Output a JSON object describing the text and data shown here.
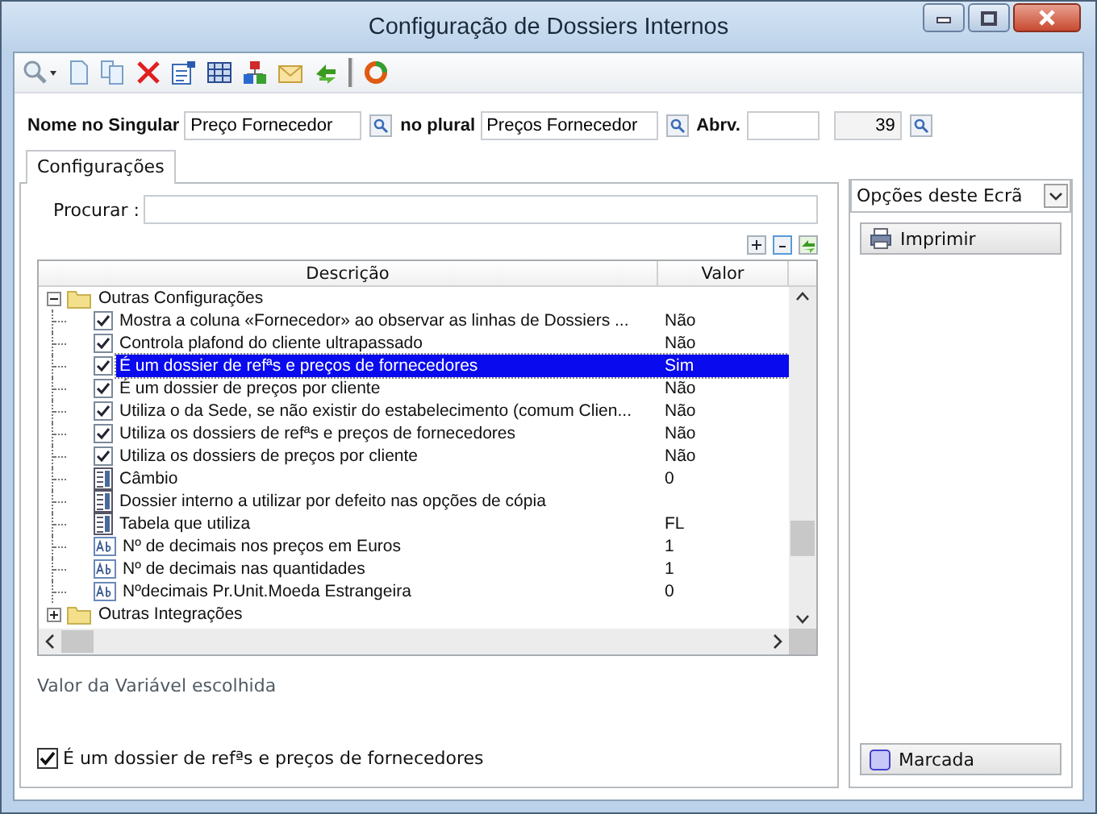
{
  "window": {
    "title": "Configuração de Dossiers Internos"
  },
  "form": {
    "singular_label": "Nome no Singular",
    "singular_value": "Preço Fornecedor",
    "plural_label": "no plural",
    "plural_value": "Preços Fornecedor",
    "abbr_label": "Abrv.",
    "number": "39"
  },
  "tabs": [
    {
      "label": "Configurações",
      "selected": true
    }
  ],
  "search": {
    "label": "Procurar :"
  },
  "tree": {
    "columns": [
      "Descrição",
      "Valor"
    ],
    "nodes": [
      {
        "label": "Outras Configurações",
        "expanded": true,
        "children": [
          {
            "kind": "checkbox",
            "label": "Mostra a coluna «Fornecedor» ao observar as linhas de Dossiers ...",
            "checked": true,
            "value": "Não",
            "selected": false
          },
          {
            "kind": "checkbox",
            "label": "Controla plafond do cliente ultrapassado",
            "checked": true,
            "value": "Não",
            "selected": false
          },
          {
            "kind": "checkbox",
            "label": "É um dossier de refªs e preços de fornecedores",
            "checked": true,
            "value": "Sim",
            "selected": true
          },
          {
            "kind": "checkbox",
            "label": "É um dossier de preços por cliente",
            "checked": true,
            "value": "Não",
            "selected": false
          },
          {
            "kind": "checkbox",
            "label": "Utiliza o da Sede, se não existir do estabelecimento (comum Clien...",
            "checked": true,
            "value": "Não",
            "selected": false
          },
          {
            "kind": "checkbox",
            "label": "Utiliza os dossiers de refªs e preços de fornecedores",
            "checked": true,
            "value": "Não",
            "selected": false
          },
          {
            "kind": "checkbox",
            "label": "Utiliza os dossiers de preços por cliente",
            "checked": true,
            "value": "Não",
            "selected": false
          },
          {
            "kind": "list",
            "label": "Câmbio",
            "value": "0",
            "selected": false
          },
          {
            "kind": "list",
            "label": "Dossier interno a utilizar por defeito nas opções de cópia",
            "selected": false
          },
          {
            "kind": "list",
            "label": "Tabela que utiliza",
            "value": "FL",
            "selected": false
          },
          {
            "kind": "text",
            "label": "Nº de decimais nos preços em Euros",
            "value": "1",
            "selected": false
          },
          {
            "kind": "text",
            "label": "Nº de decimais nas quantidades",
            "value": "1",
            "selected": false
          },
          {
            "kind": "text",
            "label": "Nºdecimais Pr.Unit.Moeda Estrangeira",
            "value": "0",
            "selected": false
          }
        ]
      },
      {
        "label": "Outras Integrações",
        "expanded": false
      }
    ]
  },
  "value_caption": "Valor da Variável escolhida",
  "selected_option": {
    "label": "É um dossier de refªs e preços de fornecedores",
    "checked": true
  },
  "side_panel": {
    "dropdown": "Opções deste Ecrã",
    "buttons": [
      {
        "label": "Imprimir",
        "kind": "print"
      },
      {
        "label": "Marcada",
        "kind": "mark"
      }
    ]
  }
}
